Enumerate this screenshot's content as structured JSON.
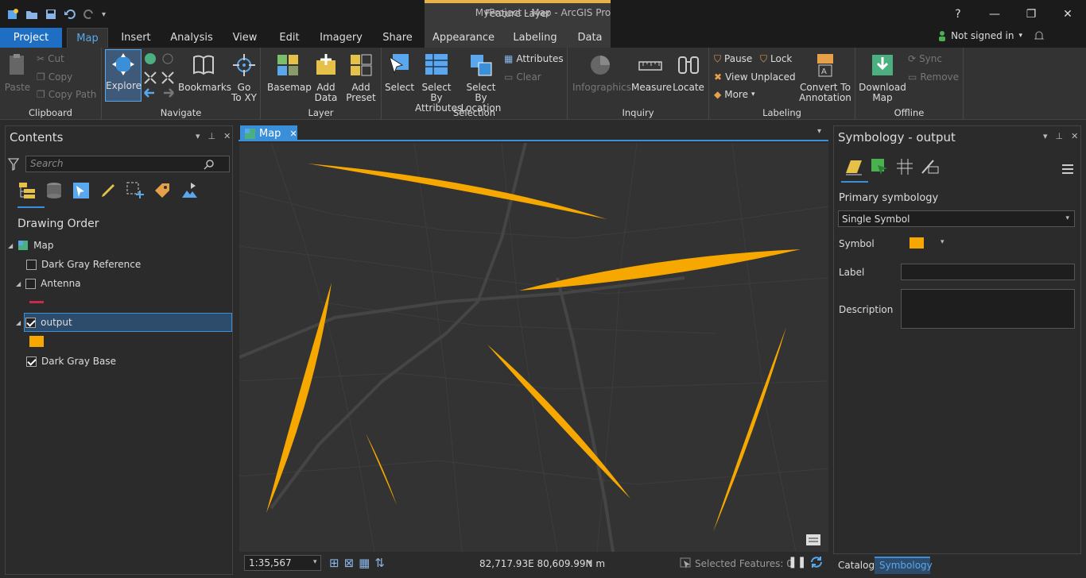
{
  "window": {
    "title": "MyProject - Map - ArcGIS Pro",
    "context_group": "Feature Layer",
    "help": "?",
    "minimize": "—",
    "restore": "❐",
    "close": "✕"
  },
  "tabs": {
    "project": "Project",
    "map": "Map",
    "insert": "Insert",
    "analysis": "Analysis",
    "view": "View",
    "edit": "Edit",
    "imagery": "Imagery",
    "share": "Share",
    "appearance": "Appearance",
    "labeling": "Labeling",
    "data": "Data"
  },
  "account": {
    "signin": "Not signed in",
    "caret": "▾"
  },
  "ribbon": {
    "clipboard": {
      "label": "Clipboard",
      "paste": "Paste",
      "cut": "Cut",
      "copy": "Copy",
      "copy_path": "Copy Path"
    },
    "navigate": {
      "label": "Navigate",
      "explore": "Explore",
      "bookmarks": "Bookmarks",
      "goto_1": "Go",
      "goto_2": "To XY"
    },
    "layer": {
      "label": "Layer",
      "basemap": "Basemap",
      "add_data_1": "Add",
      "add_data_2": "Data",
      "add_preset_1": "Add",
      "add_preset_2": "Preset"
    },
    "selection": {
      "label": "Selection",
      "select": "Select",
      "by_attr_1": "Select By",
      "by_attr_2": "Attributes",
      "by_loc_1": "Select By",
      "by_loc_2": "Location",
      "attributes": "Attributes",
      "clear": "Clear"
    },
    "inquiry": {
      "label": "Inquiry",
      "infographics": "Infographics",
      "measure": "Measure",
      "locate": "Locate"
    },
    "labeling": {
      "label": "Labeling",
      "pause": "Pause",
      "lock": "Lock",
      "view_unplaced": "View Unplaced",
      "more": "More",
      "convert_1": "Convert To",
      "convert_2": "Annotation"
    },
    "offline": {
      "label": "Offline",
      "download_1": "Download",
      "download_2": "Map",
      "sync": "Sync",
      "remove": "Remove"
    }
  },
  "contents": {
    "title": "Contents",
    "search_placeholder": "Search",
    "drawing_order": "Drawing Order",
    "layers": [
      {
        "name": "Map"
      },
      {
        "name": "Dark Gray Reference",
        "checked": false
      },
      {
        "name": "Antenna",
        "checked": false,
        "swatch": "#c8294f"
      },
      {
        "name": "output",
        "checked": true,
        "selected": true,
        "swatch": "#f6a800"
      },
      {
        "name": "Dark Gray Base",
        "checked": true
      }
    ]
  },
  "map_tab": {
    "label": "Map",
    "close": "✕"
  },
  "status": {
    "scale": "1:35,567",
    "coords": "82,717.93E 80,609.99N m",
    "coords_caret": "▾",
    "selected": "Selected Features: 0"
  },
  "symbology": {
    "title": "Symbology - output",
    "primary": "Primary symbology",
    "renderer": "Single Symbol",
    "symbol_label": "Symbol",
    "symbol_color": "#f6a800",
    "label_label": "Label",
    "label_value": "",
    "description_label": "Description",
    "description_value": ""
  },
  "bottom_tabs": {
    "catalog": "Catalog",
    "symbology": "Symbology"
  },
  "colors": {
    "accent": "#1e6fc3",
    "feature": "#f6a800",
    "ribbon": "#333333",
    "background": "#2b2b2b"
  }
}
